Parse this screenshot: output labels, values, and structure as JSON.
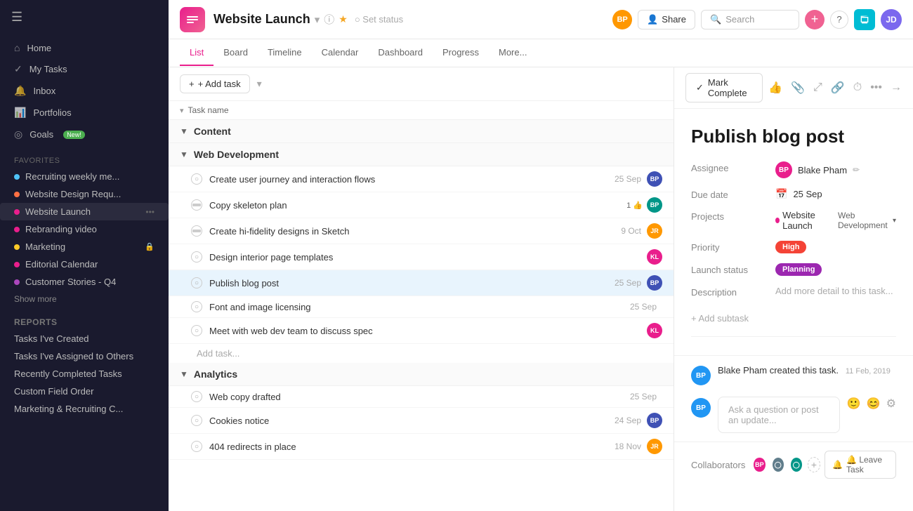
{
  "sidebar": {
    "nav_items": [
      {
        "label": "Home",
        "icon": "⌂"
      },
      {
        "label": "My Tasks",
        "icon": "✓"
      },
      {
        "label": "Inbox",
        "icon": "🔔"
      },
      {
        "label": "Portfolios",
        "icon": "📊"
      },
      {
        "label": "Goals",
        "icon": "👤",
        "badge": "New!"
      }
    ],
    "favorites_title": "Favorites",
    "favorites": [
      {
        "label": "Recruiting weekly me...",
        "color": "#4fc3f7"
      },
      {
        "label": "Website Design Requ...",
        "color": "#ff7043"
      },
      {
        "label": "Website Launch",
        "color": "#e91e8c",
        "active": true
      },
      {
        "label": "Rebranding video",
        "color": "#e91e8c"
      },
      {
        "label": "Marketing",
        "color": "#ffca28",
        "lock": true
      },
      {
        "label": "Editorial Calendar",
        "color": "#e91e8c"
      },
      {
        "label": "Customer Stories - Q4",
        "color": "#ab47bc"
      }
    ],
    "show_more": "Show more",
    "reports_title": "Reports",
    "report_items": [
      "Tasks I've Created",
      "Tasks I've Assigned to Others",
      "Recently Completed Tasks",
      "Custom Field Order",
      "Marketing & Recruiting C..."
    ]
  },
  "topbar": {
    "project_name": "Website Launch",
    "set_status": "Set status",
    "share_label": "Share",
    "search_placeholder": "Search",
    "tabs": [
      "List",
      "Board",
      "Timeline",
      "Calendar",
      "Dashboard",
      "Progress",
      "More..."
    ]
  },
  "task_list": {
    "add_task": "+ Add task",
    "col_header": "Task name",
    "sections": [
      {
        "name": "Content",
        "tasks": []
      },
      {
        "name": "Web Development",
        "tasks": [
          {
            "name": "Create user journey and interaction flows",
            "date": "25 Sep",
            "avatar": "BP",
            "av_color": "av-indigo",
            "subtask": false
          },
          {
            "name": "Copy skeleton plan",
            "date": "",
            "avatar": "BP",
            "av_color": "av-teal",
            "subtask": true,
            "like": "1"
          },
          {
            "name": "Create hi-fidelity designs in Sketch",
            "date": "9 Oct",
            "avatar": "JR",
            "av_color": "av-orange",
            "subtask": true
          },
          {
            "name": "Design interior page templates",
            "date": "",
            "avatar": "KL",
            "av_color": "av-pink",
            "subtask": false
          },
          {
            "name": "Publish blog post",
            "date": "25 Sep",
            "avatar": "BP",
            "av_color": "av-indigo",
            "subtask": false,
            "selected": true
          },
          {
            "name": "Font and image licensing",
            "date": "25 Sep",
            "avatar": null,
            "subtask": false
          },
          {
            "name": "Meet with web dev team to discuss spec",
            "date": "",
            "avatar": "KL",
            "av_color": "av-pink",
            "subtask": false
          }
        ],
        "add_task": "Add task..."
      },
      {
        "name": "Analytics",
        "tasks": [
          {
            "name": "Web copy drafted",
            "date": "25 Sep",
            "avatar": null,
            "subtask": false
          },
          {
            "name": "Cookies notice",
            "date": "24 Sep",
            "avatar": "BP",
            "av_color": "av-indigo",
            "subtask": false
          },
          {
            "name": "404 redirects in place",
            "date": "18 Nov",
            "avatar": "JR",
            "av_color": "av-orange",
            "subtask": false
          }
        ]
      }
    ]
  },
  "detail": {
    "mark_complete": "Mark Complete",
    "title": "Publish blog post",
    "assignee_label": "Assignee",
    "assignee_name": "Blake Pham",
    "due_date_label": "Due date",
    "due_date": "25 Sep",
    "projects_label": "Projects",
    "project1": "Website Launch",
    "project2": "Web Development",
    "priority_label": "Priority",
    "priority": "High",
    "launch_status_label": "Launch status",
    "launch_status": "Planning",
    "description_label": "Description",
    "description_placeholder": "Add more detail to this task...",
    "add_subtask": "+ Add subtask",
    "comment_placeholder": "Ask a question or post an update...",
    "creator_note": "Blake Pham created this task.",
    "creator_date": "11 Feb, 2019",
    "collaborators_label": "Collaborators",
    "leave_task": "🔔 Leave Task"
  }
}
